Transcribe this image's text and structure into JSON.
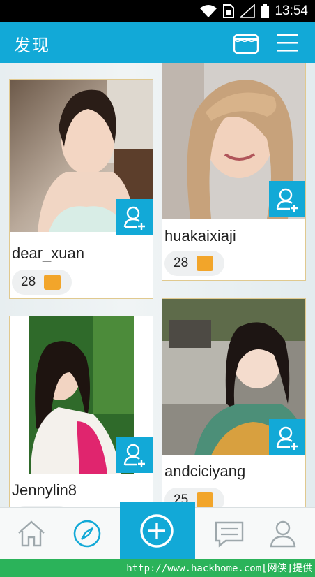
{
  "status_bar": {
    "time": "13:54"
  },
  "header": {
    "title": "发现"
  },
  "cards": [
    {
      "name": "dear_xuan",
      "count": "28"
    },
    {
      "name": "huakaixiaji",
      "count": "28"
    },
    {
      "name": "Jennylin8",
      "count": ""
    },
    {
      "name": "andciciyang",
      "count": "25"
    }
  ],
  "footer": {
    "url": "http://www.hackhome.com[网侠]提供"
  },
  "colors": {
    "accent": "#12a9d7",
    "badge": "#f2a52a",
    "footer": "#2bb35a"
  }
}
